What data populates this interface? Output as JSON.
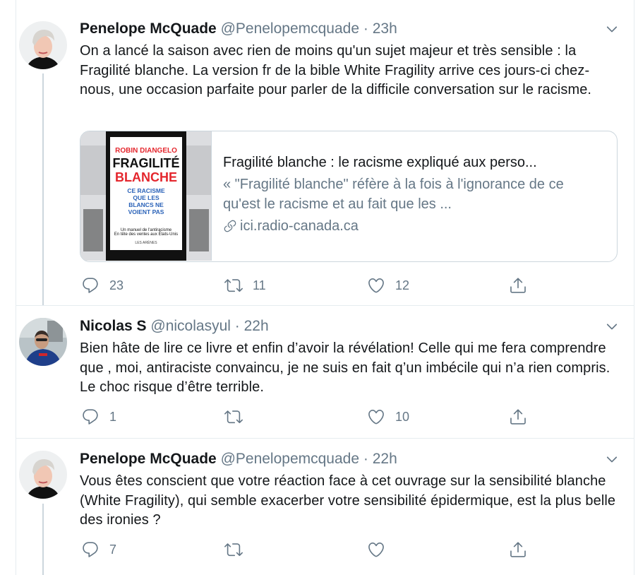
{
  "tweets": [
    {
      "name": "Penelope McQuade",
      "handle": "@Penelopemcquade",
      "dot": "·",
      "time": "23h",
      "text": "On a lancé la saison avec rien de moins qu'un sujet majeur et très sensible : la Fragilité blanche. La version fr de la bible White Fragility arrive ces jours-ci chez-nous, une occasion parfaite pour parler de la difficile conversation sur le racisme.",
      "card": {
        "book": {
          "author": "ROBIN DIANGELO",
          "title_line1": "FRAGILITÉ",
          "title_line2": "BLANCHE",
          "subtitle": "CE RACISME QUE LES BLANCS NE VOIENT PAS",
          "tagline1": "Un manuel de l'antiracisme",
          "tagline2": "En tête des ventes aux États-Unis",
          "publisher": "LES ARÈNES"
        },
        "title": "Fragilité blanche : le racisme expliqué aux perso...",
        "description": "« \"Fragilité blanche\" réfère à la fois à l'ignorance de ce qu'est le racisme et au fait que les ...",
        "domain": "ici.radio-canada.ca"
      },
      "replies": "23",
      "retweets": "11",
      "likes": "12"
    },
    {
      "name": "Nicolas S",
      "handle": "@nicolasyul",
      "dot": "·",
      "time": "22h",
      "text": "Bien hâte de lire ce livre et enfin d’avoir la révélation! Celle qui me fera comprendre que , moi, antiraciste convaincu, je ne suis en fait q’un imbécile qui n’a rien compris. Le choc risque d’être terrible.",
      "replies": "1",
      "retweets": "",
      "likes": "10"
    },
    {
      "name": "Penelope McQuade",
      "handle": "@Penelopemcquade",
      "dot": "·",
      "time": "22h",
      "text": "Vous êtes conscient que votre réaction face à cet ouvrage sur la sensibilité blanche (White Fragility), qui semble exacerber votre sensibilité épidermique, est la plus belle des ironies ?",
      "replies": "7",
      "retweets": "",
      "likes": ""
    }
  ],
  "colors": {
    "text": "#14171a",
    "secondary": "#657786",
    "border": "#e6ecf0",
    "thread": "#ccd6dd",
    "book_red": "#e4262d"
  },
  "icons": [
    "reply-icon",
    "retweet-icon",
    "like-icon",
    "share-icon",
    "chevron-down-icon",
    "link-icon"
  ]
}
